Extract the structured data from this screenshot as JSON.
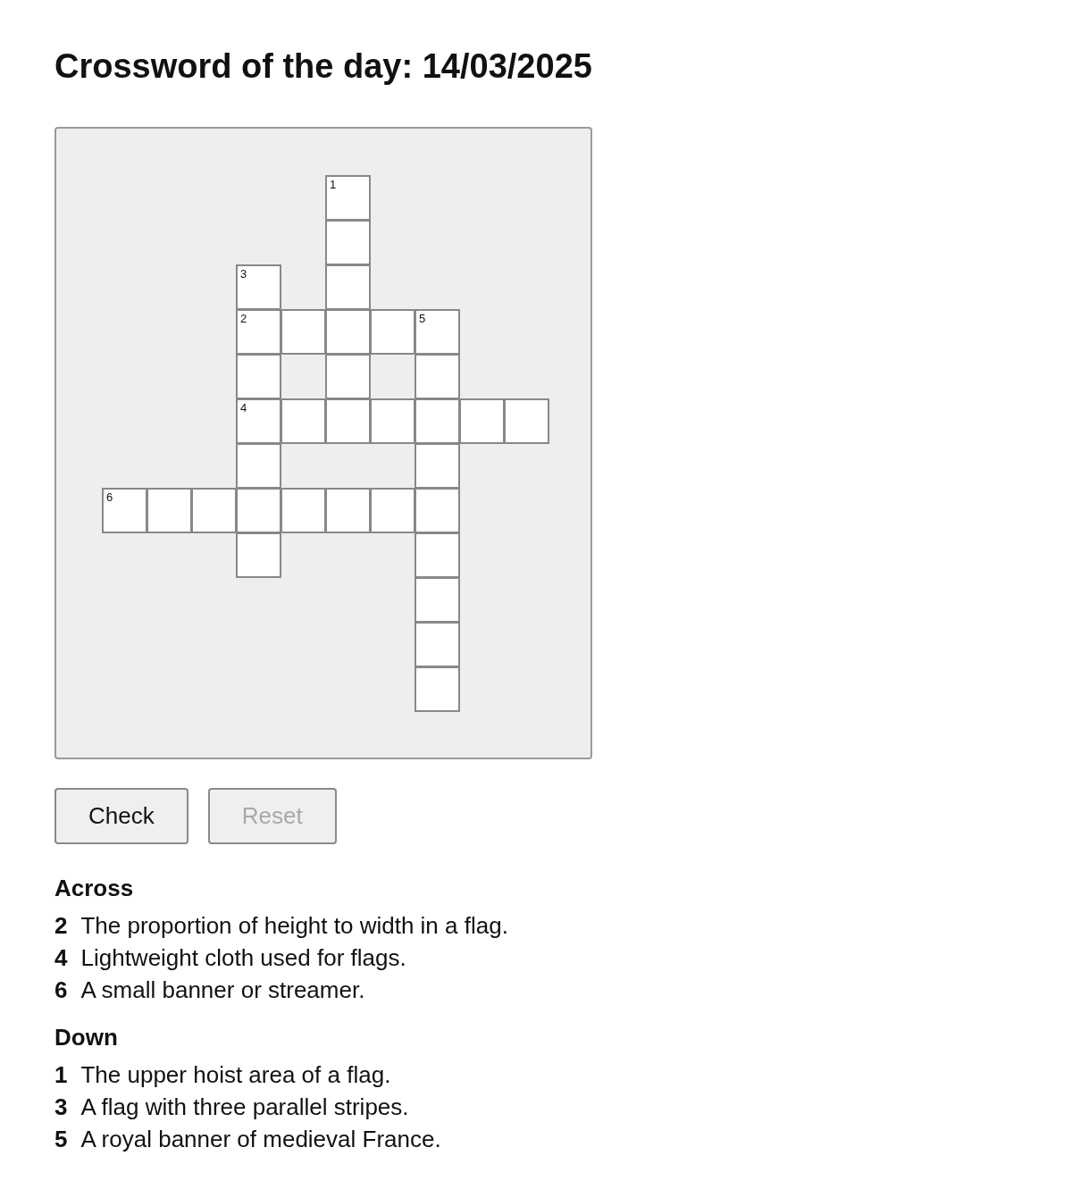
{
  "title": "Crossword of the day: 14/03/2025",
  "grid": [
    [
      {
        "kind": "blank"
      },
      {
        "kind": "blank"
      },
      {
        "kind": "blank"
      },
      {
        "kind": "blank"
      },
      {
        "kind": "blank"
      },
      {
        "kind": "square",
        "number": "1"
      },
      {
        "kind": "blank"
      },
      {
        "kind": "blank"
      },
      {
        "kind": "blank"
      },
      {
        "kind": "blank"
      }
    ],
    [
      {
        "kind": "blank"
      },
      {
        "kind": "blank"
      },
      {
        "kind": "blank"
      },
      {
        "kind": "blank"
      },
      {
        "kind": "blank"
      },
      {
        "kind": "square"
      },
      {
        "kind": "blank"
      },
      {
        "kind": "blank"
      },
      {
        "kind": "blank"
      },
      {
        "kind": "blank"
      }
    ],
    [
      {
        "kind": "blank"
      },
      {
        "kind": "blank"
      },
      {
        "kind": "blank"
      },
      {
        "kind": "square",
        "number": "3"
      },
      {
        "kind": "blank"
      },
      {
        "kind": "square"
      },
      {
        "kind": "blank"
      },
      {
        "kind": "blank"
      },
      {
        "kind": "blank"
      },
      {
        "kind": "blank"
      }
    ],
    [
      {
        "kind": "blank"
      },
      {
        "kind": "blank"
      },
      {
        "kind": "blank"
      },
      {
        "kind": "square",
        "number": "2"
      },
      {
        "kind": "square"
      },
      {
        "kind": "square"
      },
      {
        "kind": "square"
      },
      {
        "kind": "square",
        "number": "5"
      },
      {
        "kind": "blank"
      },
      {
        "kind": "blank"
      }
    ],
    [
      {
        "kind": "blank"
      },
      {
        "kind": "blank"
      },
      {
        "kind": "blank"
      },
      {
        "kind": "square"
      },
      {
        "kind": "blank"
      },
      {
        "kind": "square"
      },
      {
        "kind": "blank"
      },
      {
        "kind": "square"
      },
      {
        "kind": "blank"
      },
      {
        "kind": "blank"
      }
    ],
    [
      {
        "kind": "blank"
      },
      {
        "kind": "blank"
      },
      {
        "kind": "blank"
      },
      {
        "kind": "square",
        "number": "4"
      },
      {
        "kind": "square"
      },
      {
        "kind": "square"
      },
      {
        "kind": "square"
      },
      {
        "kind": "square"
      },
      {
        "kind": "square"
      },
      {
        "kind": "square"
      }
    ],
    [
      {
        "kind": "blank"
      },
      {
        "kind": "blank"
      },
      {
        "kind": "blank"
      },
      {
        "kind": "square"
      },
      {
        "kind": "blank"
      },
      {
        "kind": "blank"
      },
      {
        "kind": "blank"
      },
      {
        "kind": "square"
      },
      {
        "kind": "blank"
      },
      {
        "kind": "blank"
      }
    ],
    [
      {
        "kind": "square",
        "number": "6"
      },
      {
        "kind": "square"
      },
      {
        "kind": "square"
      },
      {
        "kind": "square"
      },
      {
        "kind": "square"
      },
      {
        "kind": "square"
      },
      {
        "kind": "square"
      },
      {
        "kind": "square"
      },
      {
        "kind": "blank"
      },
      {
        "kind": "blank"
      }
    ],
    [
      {
        "kind": "blank"
      },
      {
        "kind": "blank"
      },
      {
        "kind": "blank"
      },
      {
        "kind": "square"
      },
      {
        "kind": "blank"
      },
      {
        "kind": "blank"
      },
      {
        "kind": "blank"
      },
      {
        "kind": "square"
      },
      {
        "kind": "blank"
      },
      {
        "kind": "blank"
      }
    ],
    [
      {
        "kind": "blank"
      },
      {
        "kind": "blank"
      },
      {
        "kind": "blank"
      },
      {
        "kind": "blank"
      },
      {
        "kind": "blank"
      },
      {
        "kind": "blank"
      },
      {
        "kind": "blank"
      },
      {
        "kind": "square"
      },
      {
        "kind": "blank"
      },
      {
        "kind": "blank"
      }
    ],
    [
      {
        "kind": "blank"
      },
      {
        "kind": "blank"
      },
      {
        "kind": "blank"
      },
      {
        "kind": "blank"
      },
      {
        "kind": "blank"
      },
      {
        "kind": "blank"
      },
      {
        "kind": "blank"
      },
      {
        "kind": "square"
      },
      {
        "kind": "blank"
      },
      {
        "kind": "blank"
      }
    ],
    [
      {
        "kind": "blank"
      },
      {
        "kind": "blank"
      },
      {
        "kind": "blank"
      },
      {
        "kind": "blank"
      },
      {
        "kind": "blank"
      },
      {
        "kind": "blank"
      },
      {
        "kind": "blank"
      },
      {
        "kind": "square"
      },
      {
        "kind": "blank"
      },
      {
        "kind": "blank"
      }
    ]
  ],
  "buttons": [
    {
      "label": "Check",
      "disabled": false
    },
    {
      "label": "Reset",
      "disabled": true
    }
  ],
  "clue_sections": [
    {
      "heading": "Across",
      "clues": [
        {
          "number": "2",
          "text": "The proportion of height to width in a flag."
        },
        {
          "number": "4",
          "text": "Lightweight cloth used for flags."
        },
        {
          "number": "6",
          "text": "A small banner or streamer."
        }
      ]
    },
    {
      "heading": "Down",
      "clues": [
        {
          "number": "1",
          "text": "The upper hoist area of a flag."
        },
        {
          "number": "3",
          "text": "A flag with three parallel stripes."
        },
        {
          "number": "5",
          "text": "A royal banner of medieval France."
        }
      ]
    }
  ]
}
